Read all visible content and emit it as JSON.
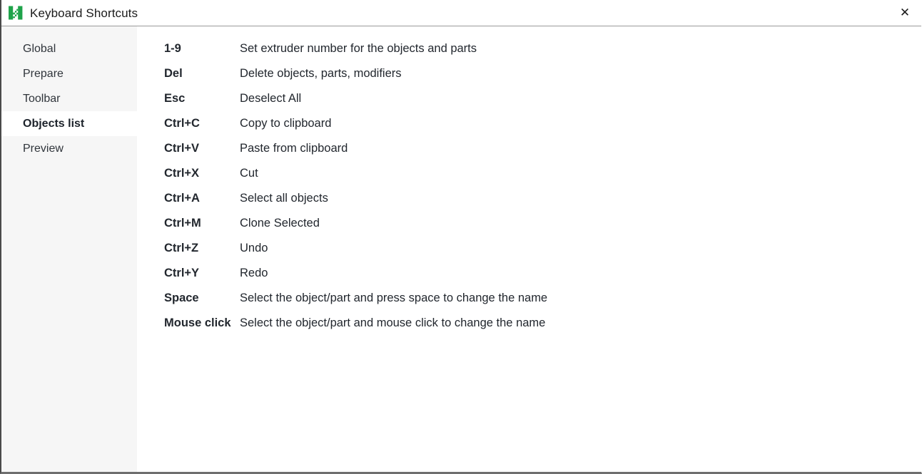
{
  "window": {
    "title": "Keyboard Shortcuts",
    "app_icon": "prusaslicer-logo-icon",
    "close_label": "✕",
    "accent_color": "#1fa34a",
    "title_color": "#1b1b1b",
    "sidebar_bg": "#f6f6f6",
    "content_bg": "#ffffff"
  },
  "sidebar": {
    "items": [
      {
        "label": "Global",
        "selected": false
      },
      {
        "label": "Prepare",
        "selected": false
      },
      {
        "label": "Toolbar",
        "selected": false
      },
      {
        "label": "Objects list",
        "selected": true
      },
      {
        "label": "Preview",
        "selected": false
      }
    ]
  },
  "main": {
    "shortcuts": [
      {
        "key": "1-9",
        "description": "Set extruder number for the objects and parts"
      },
      {
        "key": "Del",
        "description": "Delete objects, parts, modifiers"
      },
      {
        "key": "Esc",
        "description": "Deselect All"
      },
      {
        "key": "Ctrl+C",
        "description": "Copy to clipboard"
      },
      {
        "key": "Ctrl+V",
        "description": "Paste from clipboard"
      },
      {
        "key": "Ctrl+X",
        "description": "Cut"
      },
      {
        "key": "Ctrl+A",
        "description": "Select all objects"
      },
      {
        "key": "Ctrl+M",
        "description": "Clone Selected"
      },
      {
        "key": "Ctrl+Z",
        "description": "Undo"
      },
      {
        "key": "Ctrl+Y",
        "description": "Redo"
      },
      {
        "key": "Space",
        "description": "Select the object/part and press space to change the name"
      },
      {
        "key": "Mouse click",
        "description": "Select the object/part and mouse click to change the name"
      }
    ]
  }
}
